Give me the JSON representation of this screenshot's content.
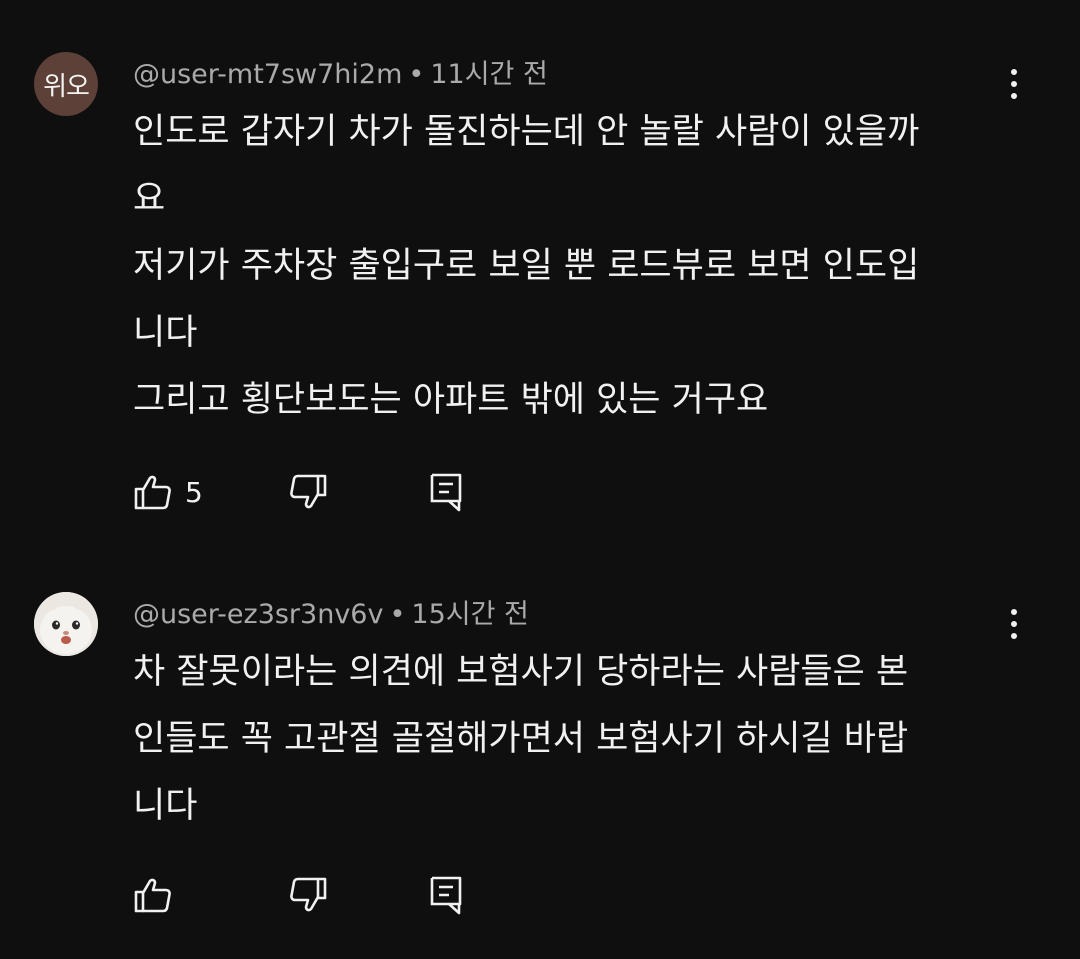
{
  "comments": [
    {
      "avatar_text": "위오",
      "avatar_color": "#5d4037",
      "author": "@user-mt7sw7hi2m",
      "separator": "•",
      "time": "11시간 전",
      "lines": [
        "인도로 갑자기 차가 돌진하는데 안 놀랄 사람이 있을까",
        "요",
        "저기가 주차장 출입구로 보일 뿐 로드뷰로 보면 인도입",
        "니다",
        "그리고 횡단보도는 아파트 밖에 있는 거구요"
      ],
      "like_count": "5",
      "icons": {
        "like": "thumbs-up-icon",
        "dislike": "thumbs-down-icon",
        "reply": "reply-icon",
        "more": "more-vert-icon"
      }
    },
    {
      "avatar_icon": "cat-avatar",
      "author": "@user-ez3sr3nv6v",
      "separator": "•",
      "time": "15시간 전",
      "lines": [
        "차 잘못이라는 의견에 보험사기 당하라는 사람들은 본",
        "인들도 꼭 고관절 골절해가면서 보험사기 하시길 바랍",
        "니다"
      ],
      "like_count": "",
      "icons": {
        "like": "thumbs-up-icon",
        "dislike": "thumbs-down-icon",
        "reply": "reply-icon",
        "more": "more-vert-icon"
      }
    }
  ],
  "colors": {
    "background": "#0f0f0f",
    "text": "#f1f1f1",
    "meta": "#aaaaaa"
  }
}
